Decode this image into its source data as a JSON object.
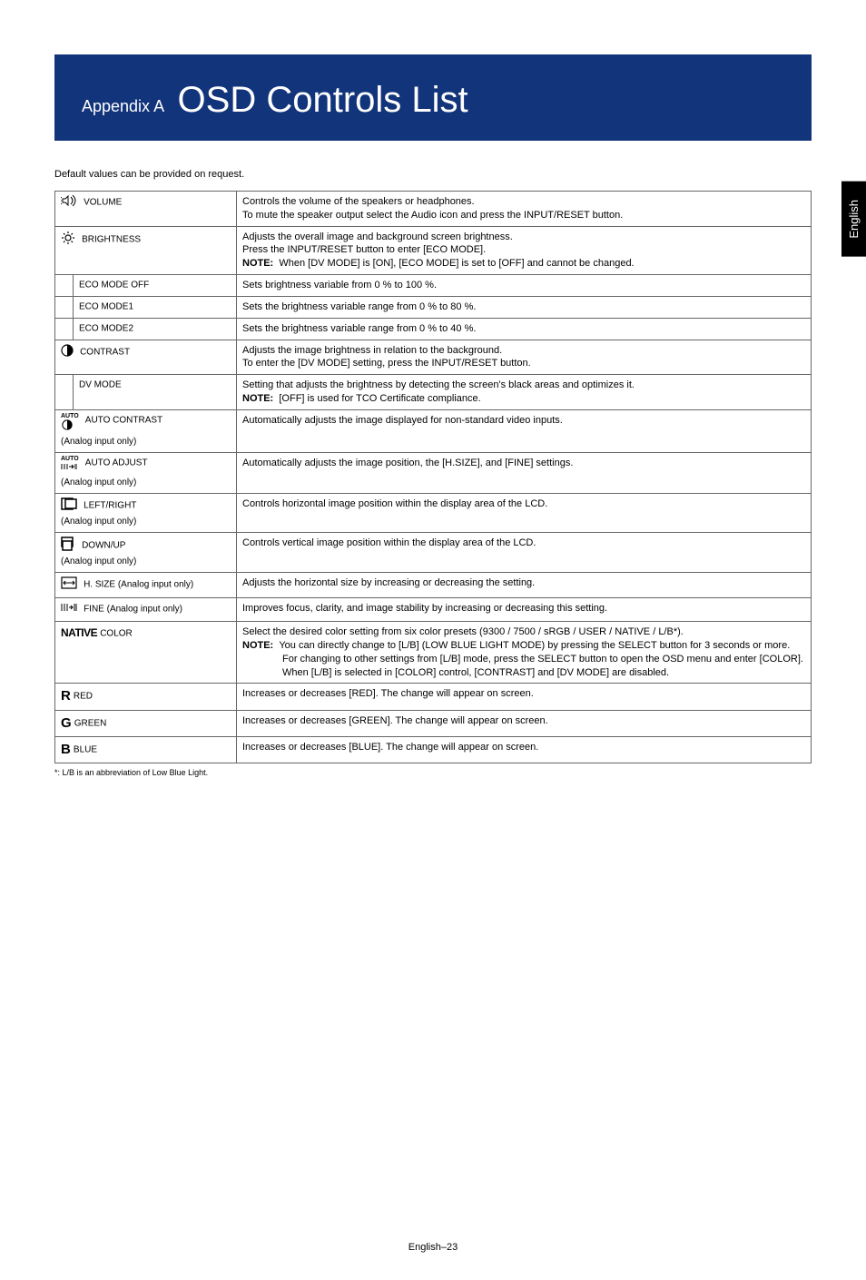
{
  "header": {
    "appendix": "Appendix A",
    "title": "OSD Controls List"
  },
  "lang_tab": "English",
  "intro": "Default values can be provided on request.",
  "rows": {
    "volume": {
      "label": "VOLUME",
      "desc": "Controls the volume of the speakers or headphones.\nTo mute the speaker output select the Audio icon and press the INPUT/RESET button."
    },
    "brightness": {
      "label": "BRIGHTNESS",
      "desc": "Adjusts the overall image and background screen brightness.\nPress the INPUT/RESET button to enter [ECO MODE].",
      "note_label": "NOTE:",
      "note": "When [DV MODE] is [ON], [ECO MODE] is set to [OFF] and cannot be changed."
    },
    "eco_off": {
      "label": "ECO MODE OFF",
      "desc": "Sets brightness variable from 0 % to 100 %."
    },
    "eco1": {
      "label": "ECO MODE1",
      "desc": "Sets the brightness variable range from 0 % to 80 %."
    },
    "eco2": {
      "label": "ECO MODE2",
      "desc": "Sets the brightness variable range from 0 % to 40 %."
    },
    "contrast": {
      "label": "CONTRAST",
      "desc": "Adjusts the image brightness in relation to the background.\nTo enter the [DV MODE] setting, press the INPUT/RESET button."
    },
    "dvmode": {
      "label": "DV MODE",
      "desc": "Setting that adjusts the brightness by detecting the screen's black areas and optimizes it.",
      "note_label": "NOTE:",
      "note": "[OFF] is used for TCO Certificate compliance."
    },
    "auto_contrast": {
      "label": "AUTO CONTRAST",
      "sublabel": "(Analog input only)",
      "desc": "Automatically adjusts the image displayed for non-standard video inputs."
    },
    "auto_adjust": {
      "label": "AUTO ADJUST",
      "sublabel": "(Analog input only)",
      "desc": "Automatically adjusts the image position, the [H.SIZE], and [FINE] settings."
    },
    "left_right": {
      "label": "LEFT/RIGHT",
      "sublabel": "(Analog input only)",
      "desc": "Controls horizontal image position within the display area of the LCD."
    },
    "down_up": {
      "label": "DOWN/UP",
      "sublabel": "(Analog input only)",
      "desc": "Controls vertical image position within the display area of the LCD."
    },
    "hsize": {
      "label": "H. SIZE (Analog input only)",
      "desc": "Adjusts the horizontal size by increasing or decreasing the setting."
    },
    "fine": {
      "label": "FINE (Analog input only)",
      "desc": "Improves focus, clarity, and image stability by increasing or decreasing this setting."
    },
    "color": {
      "label": "COLOR",
      "desc": "Select the desired color setting from six color presets (9300 / 7500 / sRGB / USER / NATIVE / L/B*).",
      "note_label": "NOTE:",
      "note1": "You can directly change to [L/B] (LOW BLUE LIGHT MODE) by pressing the SELECT button for 3 seconds or more.",
      "note2": "For changing to other settings from [L/B] mode, press the SELECT button to open the OSD menu and enter [COLOR].",
      "note3": "When [L/B] is selected in [COLOR] control, [CONTRAST] and [DV MODE] are disabled."
    },
    "red": {
      "letter": "R",
      "label": "RED",
      "desc": "Increases or decreases [RED]. The change will appear on screen."
    },
    "green": {
      "letter": "G",
      "label": "GREEN",
      "desc": "Increases or decreases [GREEN]. The change will appear on screen."
    },
    "blue": {
      "letter": "B",
      "label": "BLUE",
      "desc": "Increases or decreases [BLUE]. The change will appear on screen."
    }
  },
  "footnote": "*: L/B is an abbreviation of Low Blue Light.",
  "page_num": "English–23",
  "auto_tag": "AUTO",
  "native_tag": "NATIVE"
}
